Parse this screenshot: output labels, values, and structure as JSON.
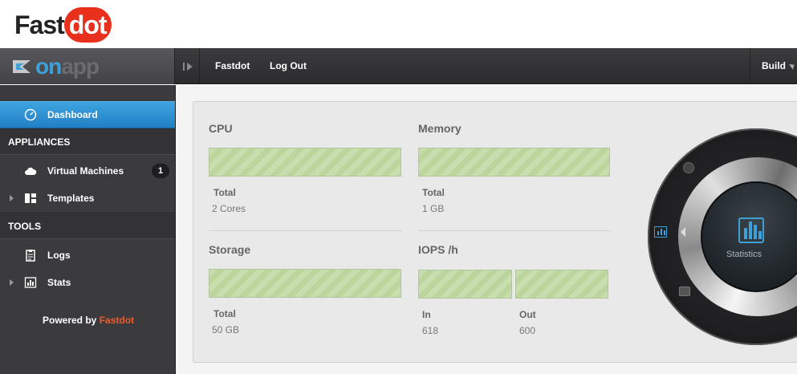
{
  "brand": {
    "fast": "Fast",
    "dot": "dot"
  },
  "onapp": {
    "on": "on",
    "app": "app"
  },
  "nav": {
    "fastdot": "Fastdot",
    "logout": "Log Out",
    "build": "Build"
  },
  "sidebar": {
    "dashboard": "Dashboard",
    "section_appliances": "APPLIANCES",
    "virtual_machines": "Virtual Machines",
    "vm_count": "1",
    "templates": "Templates",
    "section_tools": "TOOLS",
    "logs": "Logs",
    "stats": "Stats",
    "powered_by": "Powered by",
    "powered_brand": "Fastdot"
  },
  "metrics": {
    "cpu": {
      "title": "CPU",
      "label": "Total",
      "value": "2 Cores"
    },
    "memory": {
      "title": "Memory",
      "label": "Total",
      "value": "1 GB"
    },
    "storage": {
      "title": "Storage",
      "label": "Total",
      "value": "50 GB"
    },
    "iops": {
      "title": "IOPS /h",
      "in_label": "In",
      "in_value": "618",
      "out_label": "Out",
      "out_value": "600"
    }
  },
  "dial": {
    "label": "Statistics"
  },
  "colors": {
    "accent": "#3fa0d8",
    "brand": "#e8301c",
    "bar": "#c9deae"
  }
}
